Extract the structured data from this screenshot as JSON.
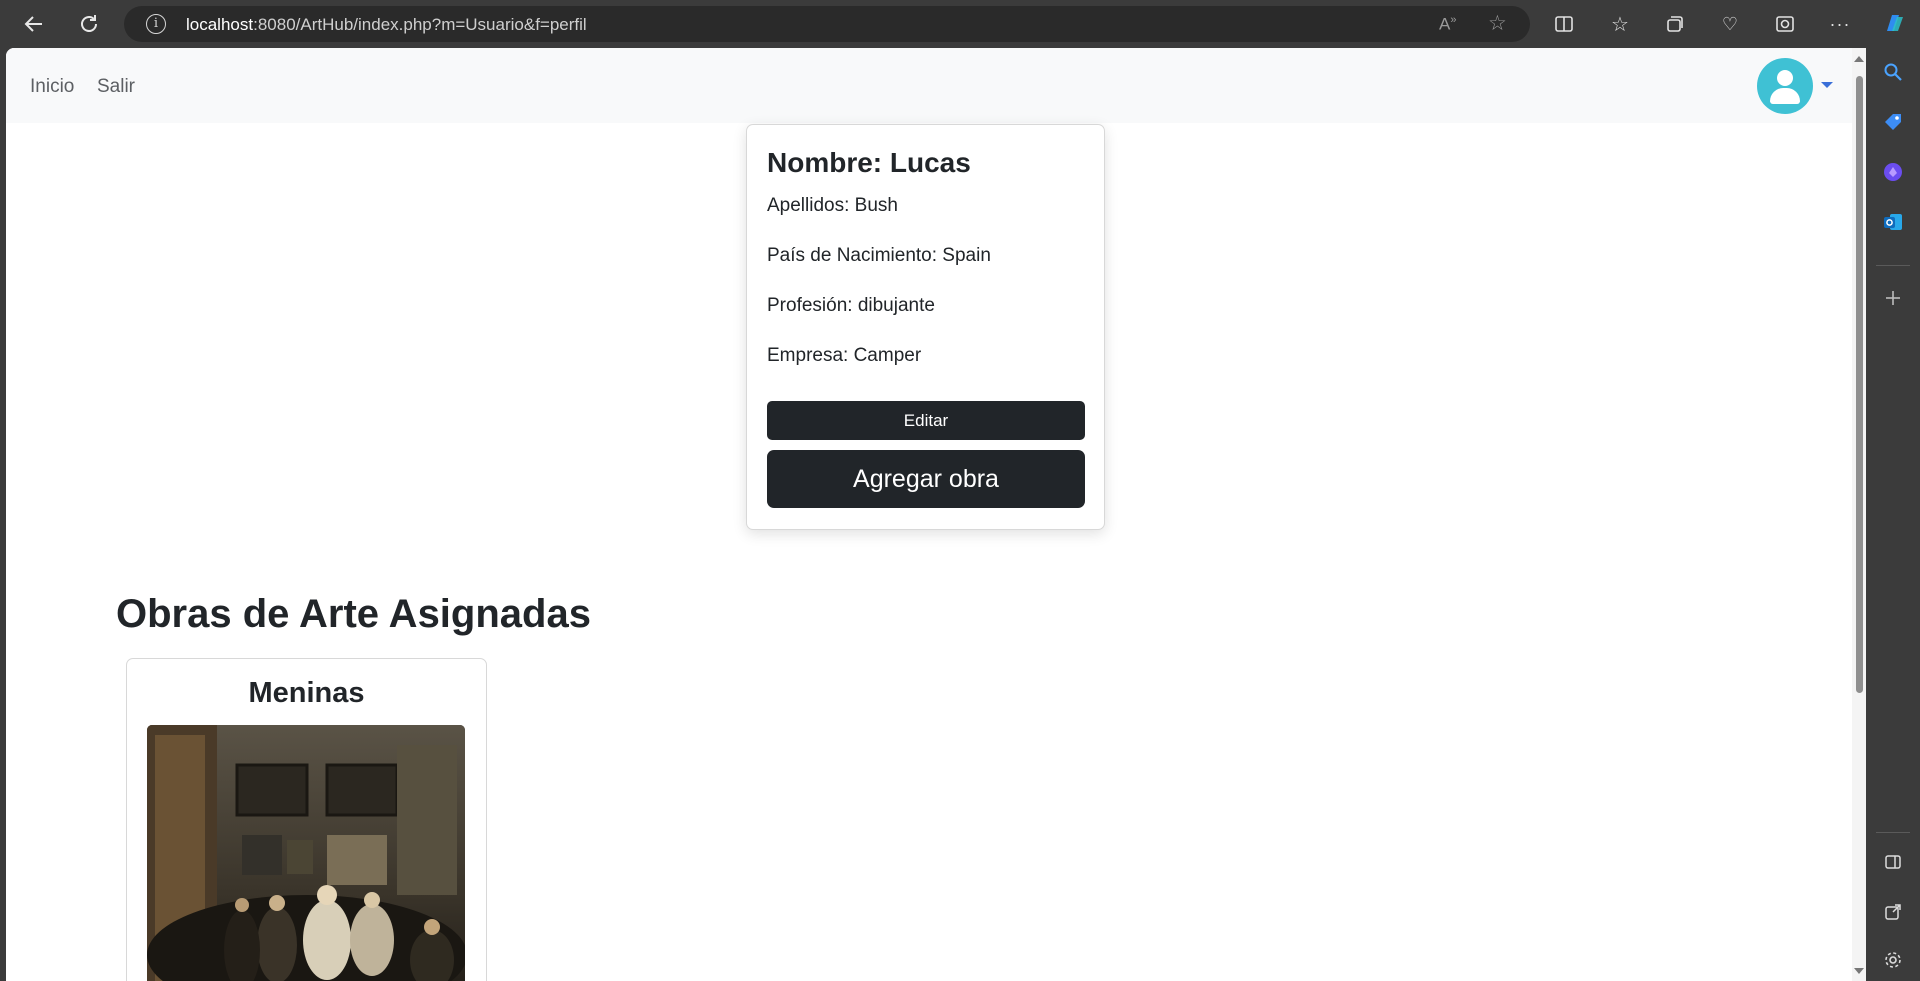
{
  "browser": {
    "url_host": "localhost",
    "url_path": ":8080/ArtHub/index.php?m=Usuario&f=perfil"
  },
  "app_nav": {
    "links": [
      "Inicio",
      "Salir"
    ]
  },
  "profile": {
    "name_line": "Nombre: Lucas",
    "lines": [
      "Apellidos: Bush",
      "País de Nacimiento: Spain",
      "Profesión: dibujante",
      "Empresa: Camper"
    ],
    "edit_label": "Editar",
    "add_label": "Agregar obra"
  },
  "artworks": {
    "heading": "Obras de Arte Asignadas",
    "items": [
      {
        "title": "Meninas"
      }
    ]
  },
  "colors": {
    "dark_button": "#212529",
    "avatar": "#3fc1d4",
    "nav_bg": "#f8f9fa"
  }
}
